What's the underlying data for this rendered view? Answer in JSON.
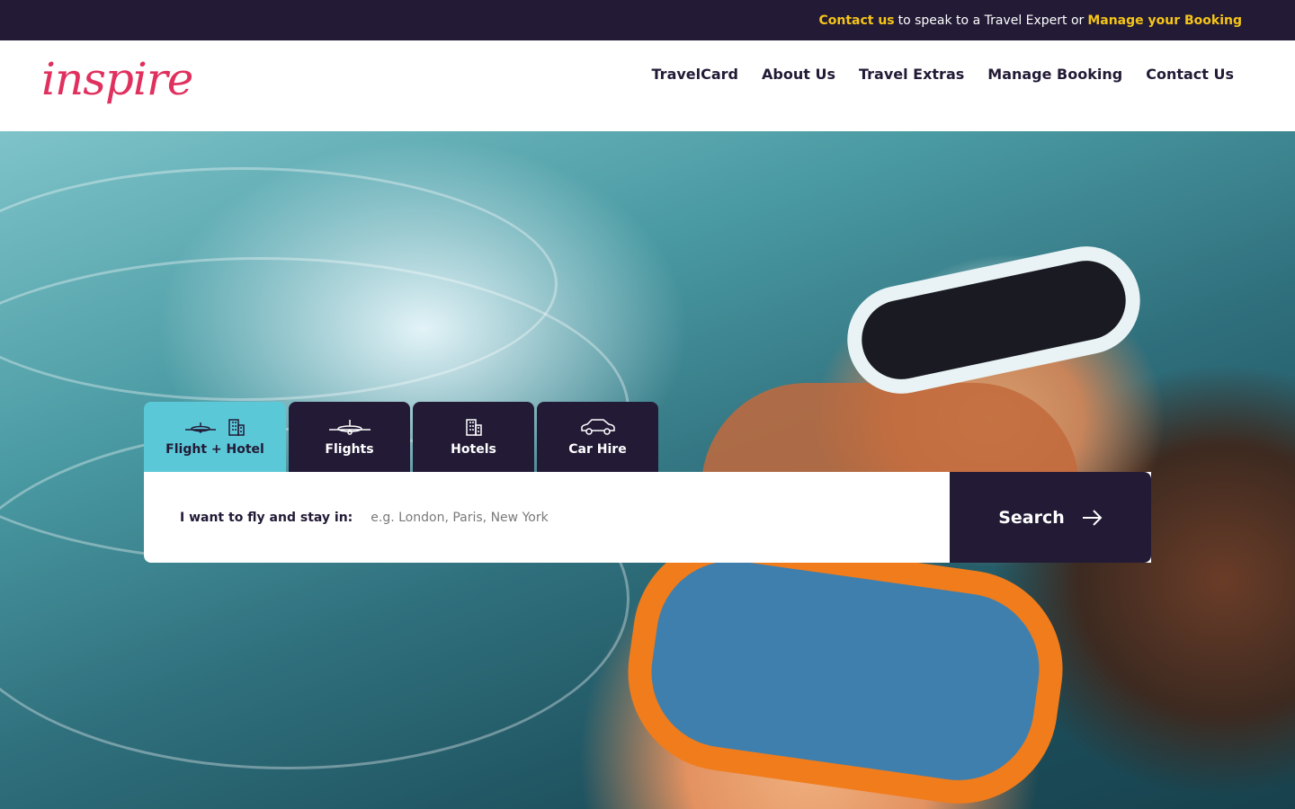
{
  "topbar": {
    "contact_link": "Contact us",
    "middle_text": "to speak to a Travel Expert or",
    "booking_link": "Manage your Booking"
  },
  "header": {
    "logo_text": "inspire",
    "nav": [
      "TravelCard",
      "About Us",
      "Travel Extras",
      "Manage Booking",
      "Contact Us"
    ]
  },
  "search": {
    "tabs": [
      {
        "label": "Flight + Hotel",
        "icons": [
          "plane-icon",
          "hotel-icon"
        ],
        "active": true
      },
      {
        "label": "Flights",
        "icons": [
          "plane-icon"
        ],
        "active": false
      },
      {
        "label": "Hotels",
        "icons": [
          "hotel-icon"
        ],
        "active": false
      },
      {
        "label": "Car Hire",
        "icons": [
          "car-icon"
        ],
        "active": false
      }
    ],
    "label": "I want to fly and stay in:",
    "placeholder": "e.g. London, Paris, New York",
    "button_label": "Search"
  },
  "colors": {
    "navy": "#231a36",
    "accent_yellow": "#f5c518",
    "logo_pink": "#e0305e",
    "active_tab": "#5bc8d8"
  }
}
